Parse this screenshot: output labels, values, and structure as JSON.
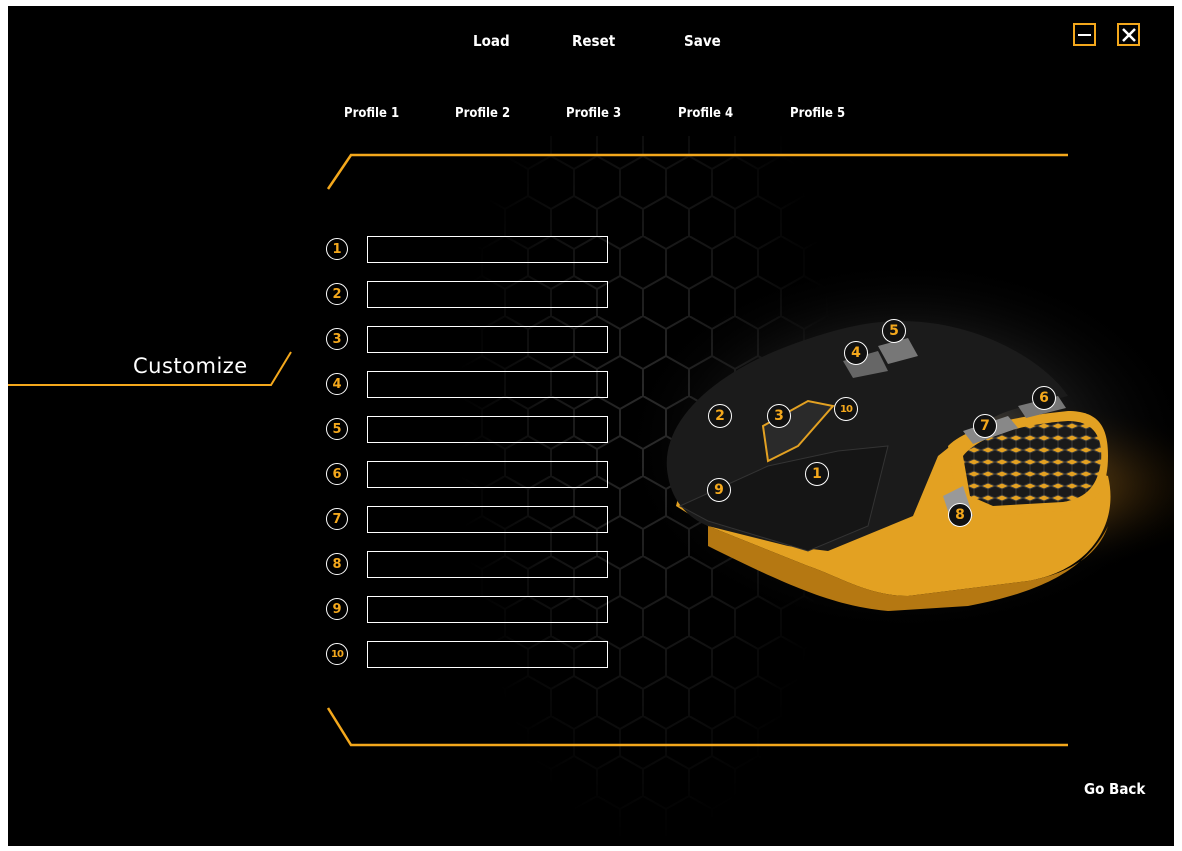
{
  "toolbar": {
    "load_label": "Load",
    "reset_label": "Reset",
    "save_label": "Save"
  },
  "window": {
    "minimize_icon": "minimize-icon",
    "close_icon": "close-icon"
  },
  "profiles": [
    "Profile 1",
    "Profile 2",
    "Profile 3",
    "Profile 4",
    "Profile 5"
  ],
  "sidebar": {
    "active_label": "Customize"
  },
  "buttons": [
    {
      "num": "1",
      "value": ""
    },
    {
      "num": "2",
      "value": ""
    },
    {
      "num": "3",
      "value": ""
    },
    {
      "num": "4",
      "value": ""
    },
    {
      "num": "5",
      "value": ""
    },
    {
      "num": "6",
      "value": ""
    },
    {
      "num": "7",
      "value": ""
    },
    {
      "num": "8",
      "value": ""
    },
    {
      "num": "9",
      "value": ""
    },
    {
      "num": "10",
      "value": ""
    }
  ],
  "mouse_callouts": [
    "1",
    "2",
    "3",
    "4",
    "5",
    "6",
    "7",
    "8",
    "9",
    "10"
  ],
  "footer": {
    "go_back_label": "Go Back"
  },
  "colors": {
    "accent": "#f4a81c",
    "background": "#000000",
    "text": "#ffffff"
  }
}
